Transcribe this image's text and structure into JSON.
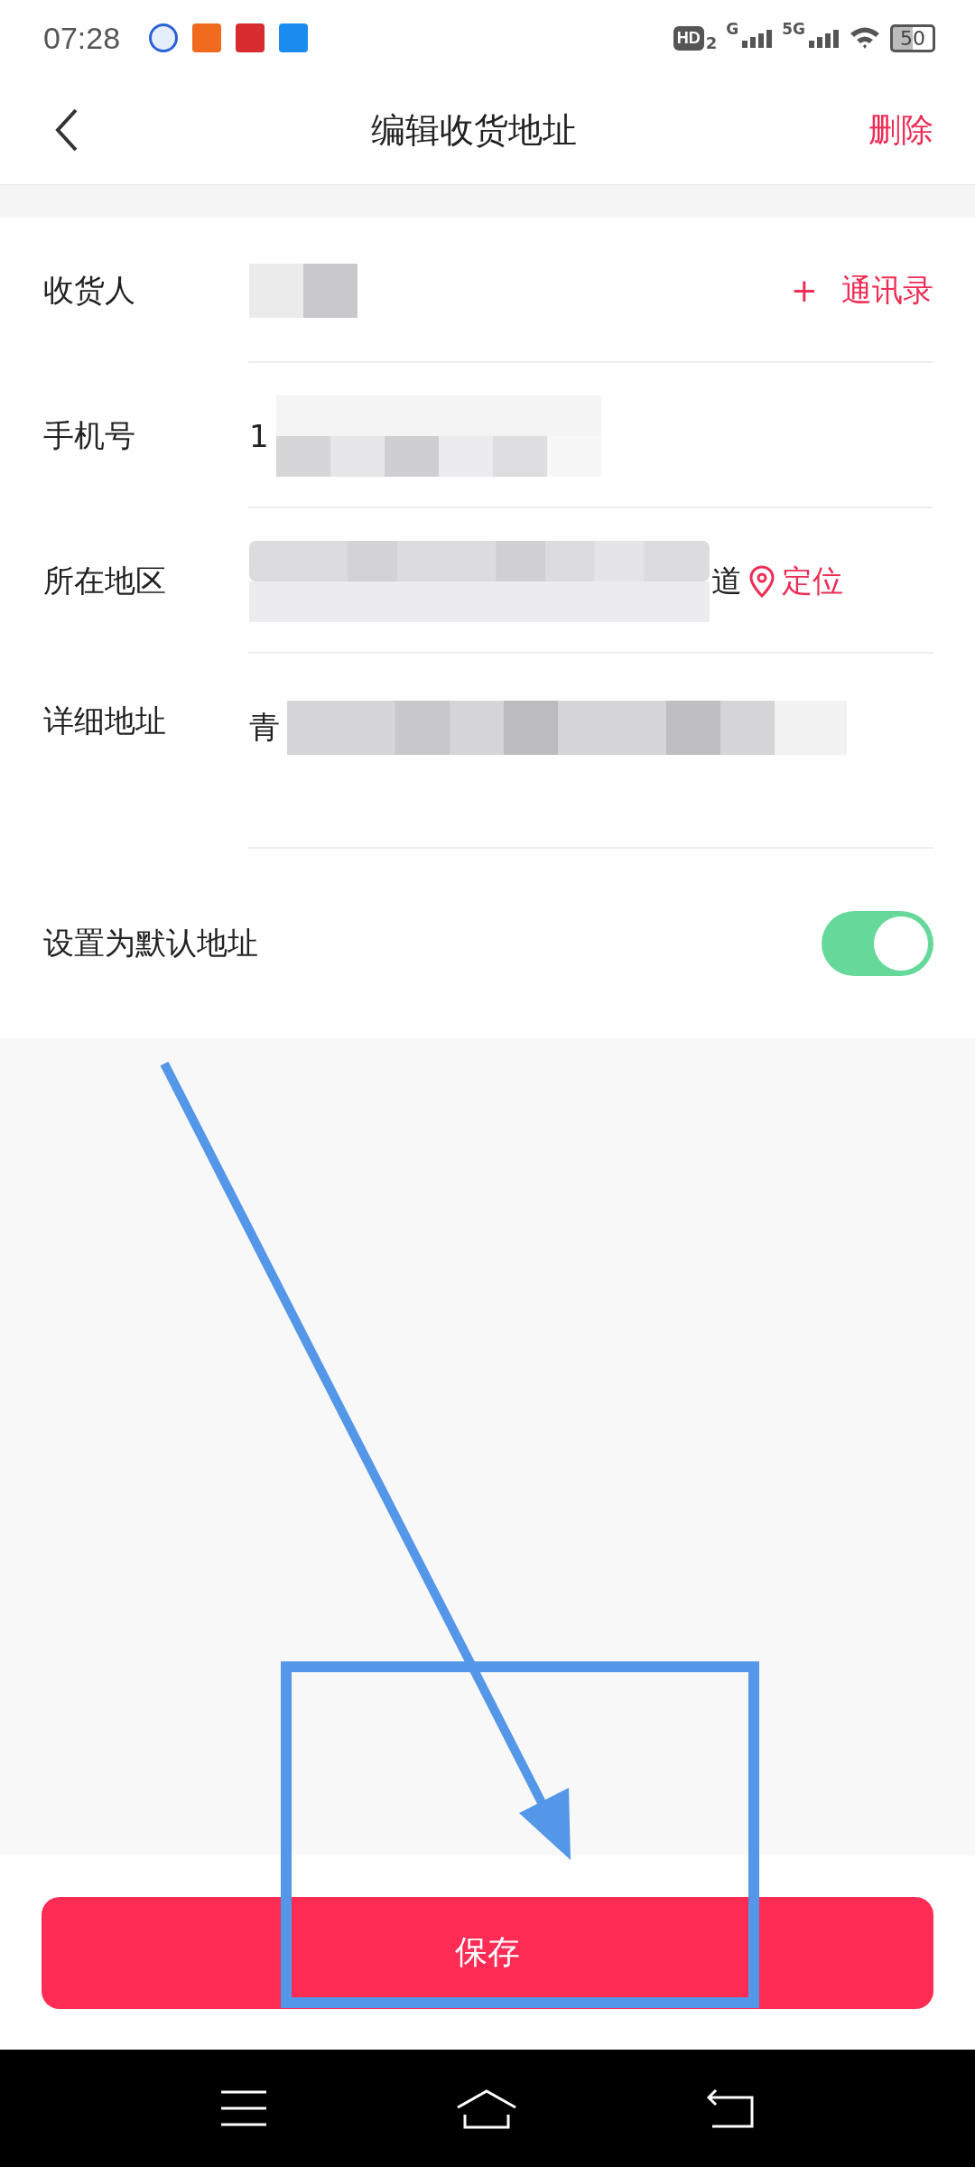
{
  "status_bar": {
    "time": "07:28",
    "hd": "HD",
    "hd_sub": "2",
    "sim1": "G",
    "sim2": "5G",
    "battery": "50"
  },
  "header": {
    "title": "编辑收货地址",
    "action": "删除"
  },
  "form": [
    {
      "kind": "contact",
      "label": "收货人",
      "action_plus": "+",
      "action": "通讯录"
    },
    {
      "kind": "phone",
      "label": "手机号",
      "value": "1"
    },
    {
      "kind": "region",
      "label": "所在地区",
      "value": "道",
      "action": "定位"
    },
    {
      "kind": "detail",
      "label": "详细地址",
      "value": "青"
    }
  ],
  "default_toggle": {
    "label": "设置为默认地址",
    "on": true
  },
  "save_button": "保存"
}
